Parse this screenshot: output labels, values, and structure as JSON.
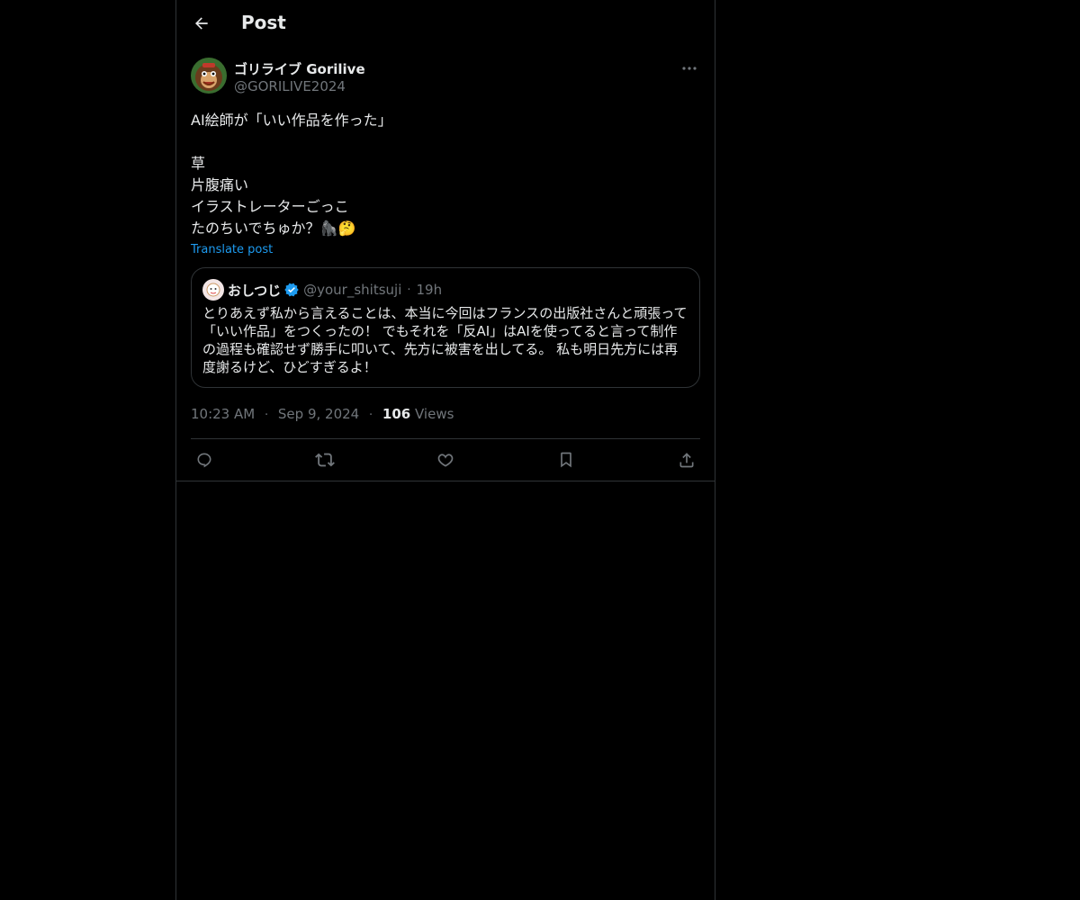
{
  "header": {
    "title": "Post",
    "back_icon": "back-arrow-icon"
  },
  "post": {
    "author_name": "ゴリライブ Gorilive",
    "author_handle": "@GORILIVE2024",
    "text_lines": [
      "AI絵師が「いい作品を作った」",
      "",
      "草",
      "片腹痛い",
      "イラストレーターごっこ",
      "たのちいでちゅか？🦍🤔"
    ],
    "translate_label": "Translate post",
    "timestamp": "10:23 AM",
    "date": "Sep 9, 2024",
    "views_count": "106",
    "views_label": "Views"
  },
  "quote": {
    "name": "おしつじ",
    "handle": "@your_shitsuji",
    "time": "19h",
    "text": "とりあえず私から言えることは、本当に今回はフランスの出版社さんと頑張って「いい作品」をつくったの！ でもそれを「反AI」はAIを使ってると言って制作の過程も確認せず勝手に叩いて、先方に被害を出してる。 私も明日先方には再度謝るけど、ひどすぎるよ！"
  },
  "actions": [
    "reply-icon",
    "repost-icon",
    "like-icon",
    "bookmark-icon",
    "share-icon"
  ],
  "colors": {
    "background": "#000000",
    "text": "#e7e9ea",
    "muted": "#71767b",
    "accent": "#1d9bf0",
    "border": "#2f3336"
  }
}
